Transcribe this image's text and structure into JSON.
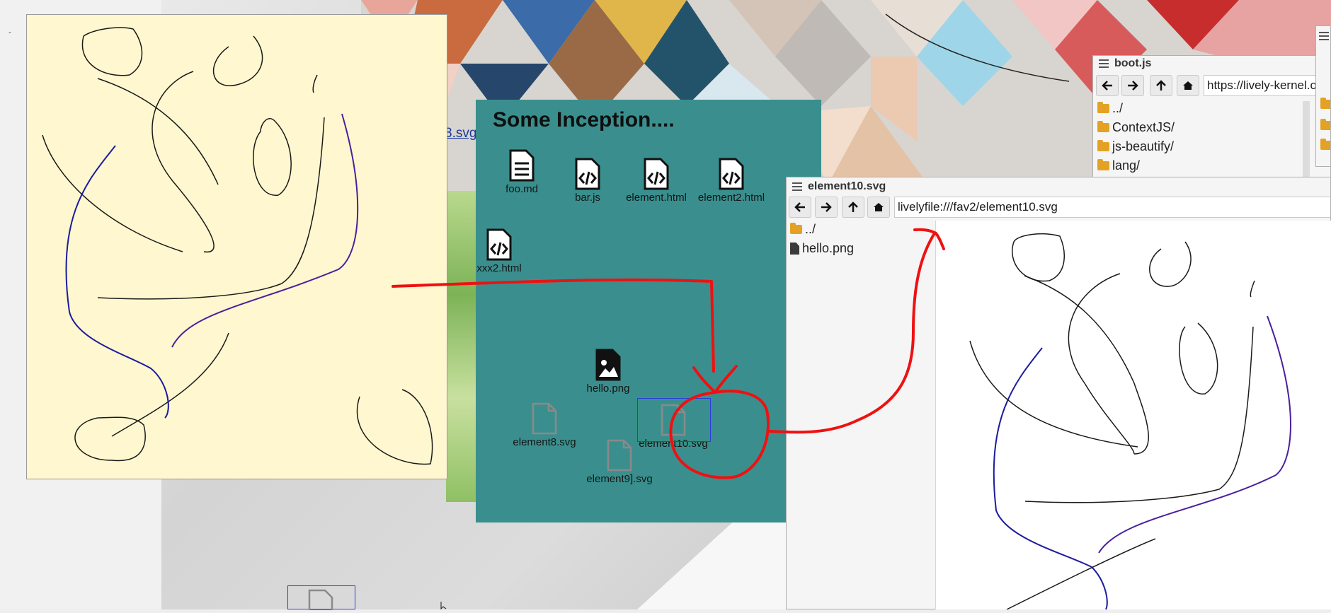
{
  "background": {
    "link_text": "3.svg",
    "side_mark": "-"
  },
  "teal_window": {
    "title": "Some Inception....",
    "files": [
      {
        "label": "foo.md",
        "icon": "markdown-file-icon"
      },
      {
        "label": "bar.js",
        "icon": "code-file-icon"
      },
      {
        "label": "element.html",
        "icon": "code-file-icon"
      },
      {
        "label": "element2.html",
        "icon": "code-file-icon"
      },
      {
        "label": "xxx2.html",
        "icon": "code-file-icon"
      },
      {
        "label": "hello.png",
        "icon": "image-file-icon"
      },
      {
        "label": "element8.svg",
        "icon": "generic-file-icon"
      },
      {
        "label": "element10.svg",
        "icon": "generic-file-icon",
        "selected": true
      },
      {
        "label": "element9].svg",
        "icon": "generic-file-icon"
      }
    ]
  },
  "boot_window": {
    "title": "boot.js",
    "url": "https://lively-kernel.org",
    "entries": [
      "../",
      "ContextJS/",
      "js-beautify/",
      "lang/"
    ]
  },
  "element_window": {
    "title": "element10.svg",
    "url": "livelyfile:///fav2/element10.svg",
    "entries": [
      {
        "label": "../",
        "kind": "folder"
      },
      {
        "label": "hello.png",
        "kind": "file"
      }
    ]
  },
  "colors": {
    "teal": "#3a8f8e",
    "canvas_yellow": "#fff7cf",
    "annotation_red": "#ee1111",
    "stroke_blue": "#1b1ba0",
    "stroke_purple": "#4a1f9e"
  }
}
